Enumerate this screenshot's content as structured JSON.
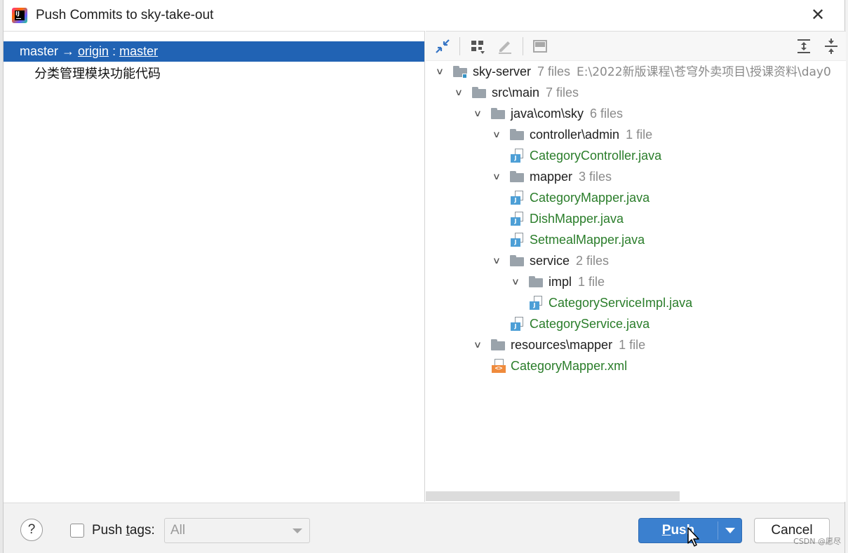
{
  "window": {
    "title": "Push Commits to sky-take-out",
    "close_glyph": "✕"
  },
  "left": {
    "branch": {
      "local": "master",
      "arrow": "→",
      "remote": "origin",
      "sep": ":",
      "remote_branch": "master"
    },
    "commits": [
      "分类管理模块功能代码"
    ]
  },
  "toolbar": {
    "icons": [
      "collapse-arrows-icon",
      "group-by-icon",
      "edit-icon",
      "preview-icon",
      "expand-all-icon",
      "collapse-all-icon"
    ]
  },
  "tree": [
    {
      "depth": 0,
      "type": "module",
      "name": "sky-server",
      "count": "7 files",
      "path": "E:\\2022新版课程\\苍穹外卖项目\\授课资料\\day0",
      "expanded": true
    },
    {
      "depth": 1,
      "type": "folder",
      "name": "src\\main",
      "count": "7 files",
      "expanded": true
    },
    {
      "depth": 2,
      "type": "folder",
      "name": "java\\com\\sky",
      "count": "6 files",
      "expanded": true
    },
    {
      "depth": 3,
      "type": "folder",
      "name": "controller\\admin",
      "count": "1 file",
      "expanded": true
    },
    {
      "depth": 4,
      "type": "java",
      "name": "CategoryController.java"
    },
    {
      "depth": 3,
      "type": "folder",
      "name": "mapper",
      "count": "3 files",
      "expanded": true
    },
    {
      "depth": 4,
      "type": "java",
      "name": "CategoryMapper.java"
    },
    {
      "depth": 4,
      "type": "java",
      "name": "DishMapper.java"
    },
    {
      "depth": 4,
      "type": "java",
      "name": "SetmealMapper.java"
    },
    {
      "depth": 3,
      "type": "folder",
      "name": "service",
      "count": "2 files",
      "expanded": true
    },
    {
      "depth": 4,
      "type": "folder",
      "name": "impl",
      "count": "1 file",
      "expanded": true
    },
    {
      "depth": 5,
      "type": "java",
      "name": "CategoryServiceImpl.java"
    },
    {
      "depth": 4,
      "type": "java",
      "name": "CategoryService.java"
    },
    {
      "depth": 2,
      "type": "folder",
      "name": "resources\\mapper",
      "count": "1 file",
      "expanded": true
    },
    {
      "depth": 3,
      "type": "xml",
      "name": "CategoryMapper.xml"
    }
  ],
  "bottom": {
    "help": "?",
    "push_tags_label": "Push tags:",
    "push_tags_checked": false,
    "tags_select": {
      "value": "All"
    },
    "push_label": "Push",
    "cancel_label": "Cancel"
  },
  "watermark": "CSDN @愿尽",
  "colors": {
    "selection": "#2163b4",
    "primary_button": "#3b80cf",
    "changed_file": "#2a7d2a",
    "muted": "#8a8a8a"
  }
}
